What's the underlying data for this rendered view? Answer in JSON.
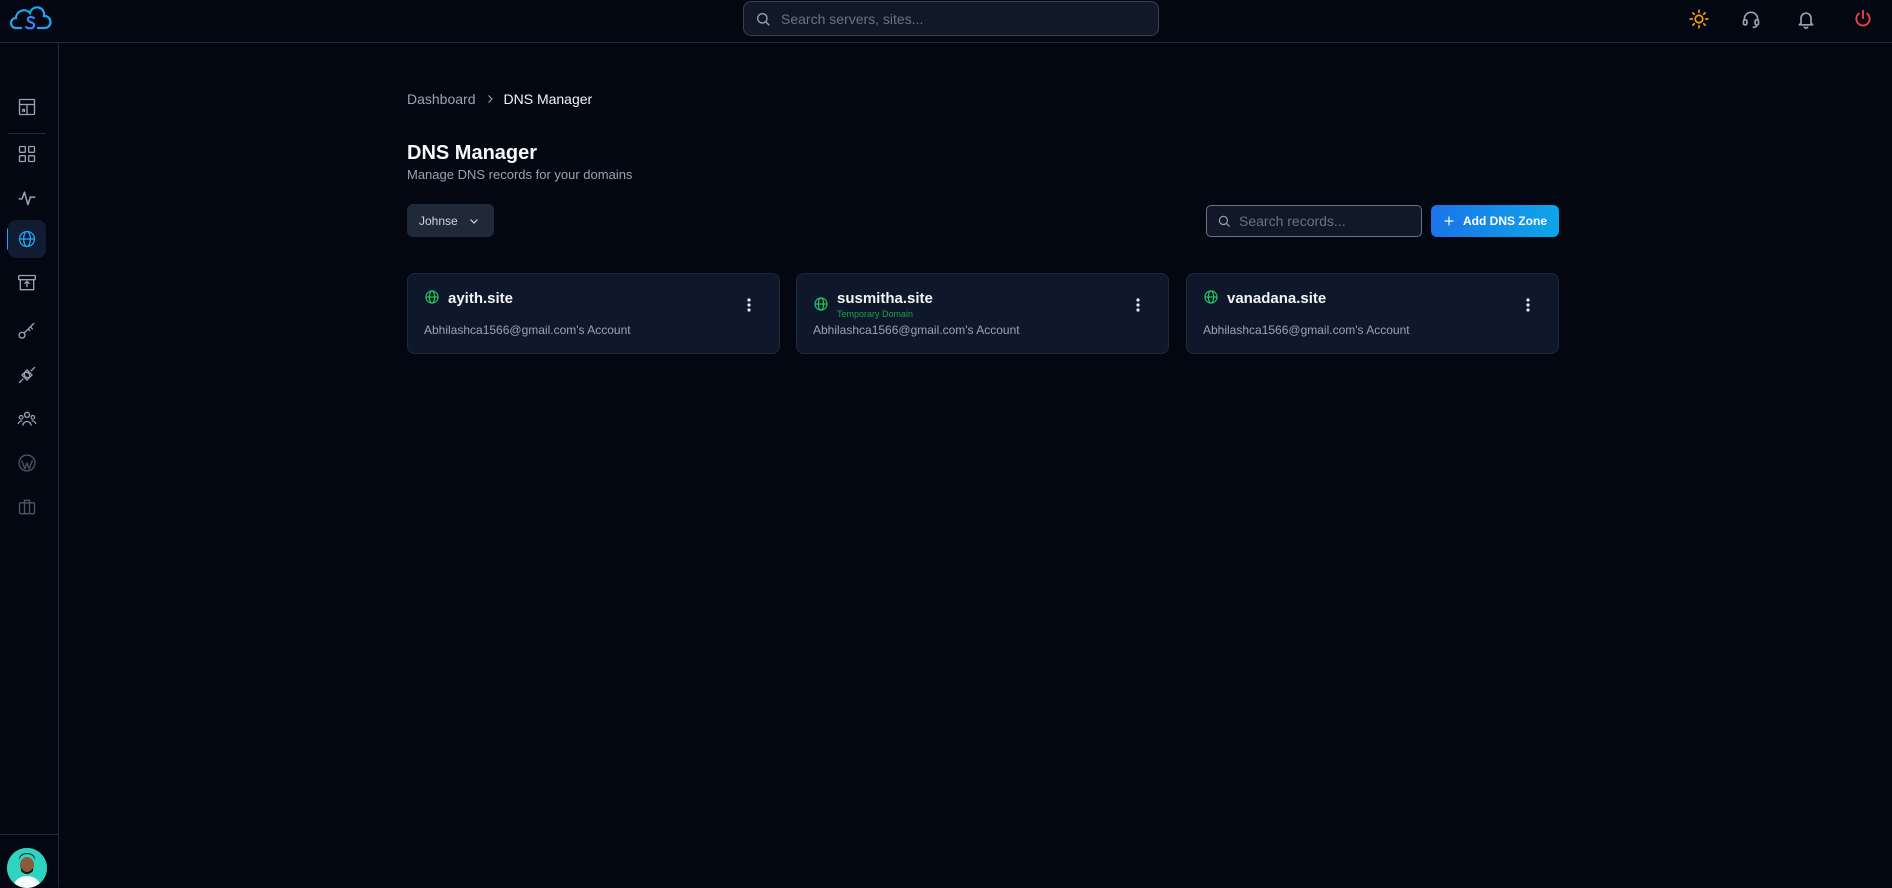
{
  "search": {
    "placeholder": "Search servers, sites..."
  },
  "sidebar": {
    "items": [
      {
        "name": "sidebar-item-overview",
        "icon": "layout-dashboard-icon"
      },
      {
        "name": "sidebar-item-apps",
        "icon": "grid-icon"
      },
      {
        "name": "sidebar-item-monitoring",
        "icon": "activity-icon"
      },
      {
        "name": "sidebar-item-dns",
        "icon": "globe-icon",
        "active": true
      },
      {
        "name": "sidebar-item-backups",
        "icon": "archive-upload-icon"
      },
      {
        "name": "sidebar-item-keys",
        "icon": "key-icon"
      },
      {
        "name": "sidebar-item-integrations",
        "icon": "plug-icon"
      },
      {
        "name": "sidebar-item-team",
        "icon": "users-icon"
      },
      {
        "name": "sidebar-item-wordpress",
        "icon": "wordpress-icon"
      },
      {
        "name": "sidebar-item-briefcase",
        "icon": "briefcase-icon"
      }
    ]
  },
  "breadcrumb": {
    "home": "Dashboard",
    "current": "DNS Manager"
  },
  "page": {
    "title": "DNS Manager",
    "subtitle": "Manage DNS records for your domains"
  },
  "filters": {
    "account_selected": "Johnse",
    "records_search_placeholder": "Search records...",
    "add_button": "Add DNS Zone"
  },
  "zones": [
    {
      "domain": "ayith.site",
      "tag": "",
      "account": "Abhilashca1566@gmail.com's Account"
    },
    {
      "domain": "susmitha.site",
      "tag": "Temporary Domain",
      "account": "Abhilashca1566@gmail.com's Account"
    },
    {
      "domain": "vanadana.site",
      "tag": "",
      "account": "Abhilashca1566@gmail.com's Account"
    }
  ],
  "colors": {
    "background": "#030712",
    "accent": "#1a74e8",
    "active_indicator": "#22a5f1",
    "domain_globe": "#22c55e",
    "sun": "#f59e0b",
    "power": "#ef4444"
  }
}
